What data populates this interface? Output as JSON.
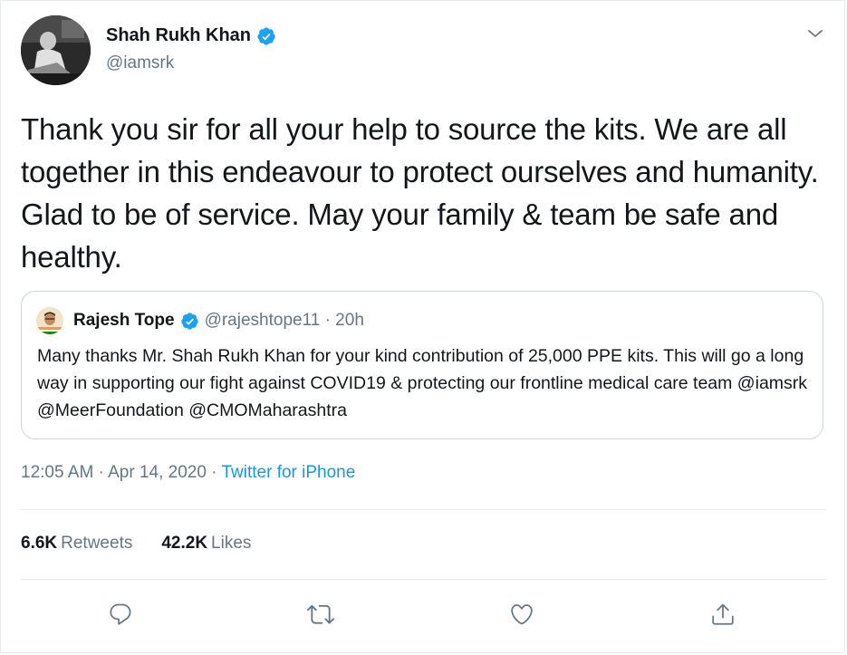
{
  "author": {
    "name": "Shah Rukh Khan",
    "handle": "@iamsrk",
    "verified": true
  },
  "tweet_text": "Thank you sir for all your help to source the kits. We are all together in this endeavour to protect ourselves and humanity. Glad to be of service. May your family & team be safe and healthy.",
  "quoted_tweet": {
    "name": "Rajesh Tope",
    "handle_time": "@rajeshtope11 · 20h",
    "verified": true,
    "text": "Many thanks Mr. Shah Rukh Khan for your kind contribution of 25,000 PPE kits. This will go a long way in supporting our fight against COVID19 & protecting our frontline medical care team @iamsrk @MeerFoundation @CMOMaharashtra"
  },
  "meta": {
    "datetime": "12:05 AM · Apr 14, 2020 · ",
    "source": "Twitter for iPhone"
  },
  "stats": {
    "retweets_count": "6.6K",
    "retweets_label": "Retweets",
    "likes_count": "42.2K",
    "likes_label": "Likes"
  },
  "icons": {
    "verified": "verified-badge-icon",
    "caret": "chevron-down-icon",
    "reply": "reply-icon",
    "retweet": "retweet-icon",
    "like": "heart-icon",
    "share": "share-icon"
  },
  "colors": {
    "verified_blue": "#1da1f2",
    "link_blue": "#1b95e0",
    "secondary_text": "#657786",
    "border": "#e6ecf0"
  }
}
